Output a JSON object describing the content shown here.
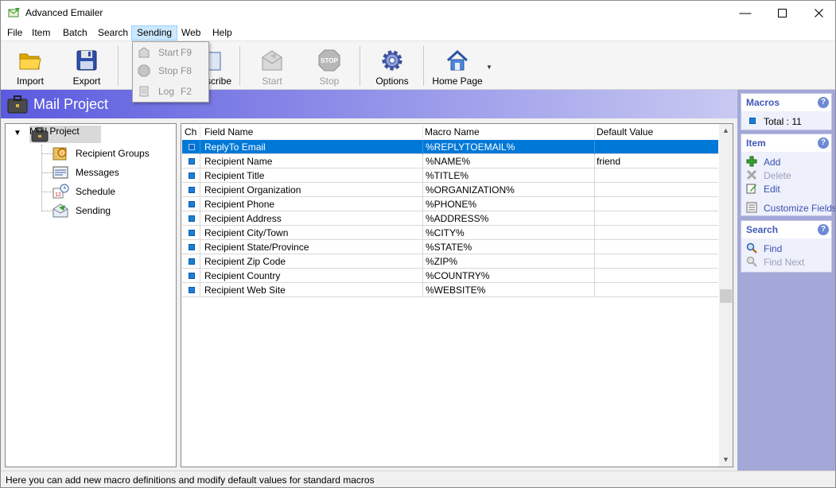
{
  "window": {
    "title": "Advanced Emailer"
  },
  "menu": {
    "items": [
      "File",
      "Item",
      "Batch",
      "Search",
      "Sending",
      "Web",
      "Help"
    ],
    "open": "Sending",
    "dropdown": [
      {
        "label": "Start",
        "key": "F9",
        "icon": "start-icon"
      },
      {
        "label": "Stop",
        "key": "F8",
        "icon": "stop-icon"
      },
      {
        "label": "Log",
        "key": "F2",
        "icon": "log-icon"
      }
    ]
  },
  "toolbar": {
    "import": "Import",
    "export": "Export",
    "subscribe_partial": "scribe",
    "start": "Start",
    "stop": "Stop",
    "options": "Options",
    "home_page": "Home Page"
  },
  "project": {
    "title": "Mail Project"
  },
  "tree": {
    "root": "Mail Project",
    "children": [
      "Recipient Groups",
      "Messages",
      "Schedule",
      "Sending"
    ]
  },
  "grid": {
    "headers": {
      "check": "Ch",
      "field": "Field Name",
      "macro": "Macro Name",
      "default": "Default Value"
    },
    "rows": [
      {
        "field": "ReplyTo Email",
        "macro": "%REPLYTOEMAIL%",
        "default": ""
      },
      {
        "field": "Recipient Name",
        "macro": "%NAME%",
        "default": "friend"
      },
      {
        "field": "Recipient Title",
        "macro": "%TITLE%",
        "default": ""
      },
      {
        "field": "Recipient Organization",
        "macro": "%ORGANIZATION%",
        "default": ""
      },
      {
        "field": "Recipient Phone",
        "macro": "%PHONE%",
        "default": ""
      },
      {
        "field": "Recipient Address",
        "macro": "%ADDRESS%",
        "default": ""
      },
      {
        "field": "Recipient City/Town",
        "macro": "%CITY%",
        "default": ""
      },
      {
        "field": "Recipient State/Province",
        "macro": "%STATE%",
        "default": ""
      },
      {
        "field": "Recipient Zip Code",
        "macro": "%ZIP%",
        "default": ""
      },
      {
        "field": "Recipient Country",
        "macro": "%COUNTRY%",
        "default": ""
      },
      {
        "field": "Recipient Web Site",
        "macro": "%WEBSITE%",
        "default": ""
      }
    ]
  },
  "side": {
    "macros": {
      "title": "Macros",
      "total": "Total : 11"
    },
    "item": {
      "title": "Item",
      "add": "Add",
      "delete": "Delete",
      "edit": "Edit",
      "customize": "Customize Fields"
    },
    "search": {
      "title": "Search",
      "find": "Find",
      "find_next": "Find Next"
    }
  },
  "status": {
    "text": "Here you can add new macro definitions and modify default values for standard macros"
  },
  "colors": {
    "accent": "#0078d7",
    "header_gradient_start": "#5a5adf",
    "side_panel": "#a3a8d8",
    "link": "#3950b0"
  }
}
